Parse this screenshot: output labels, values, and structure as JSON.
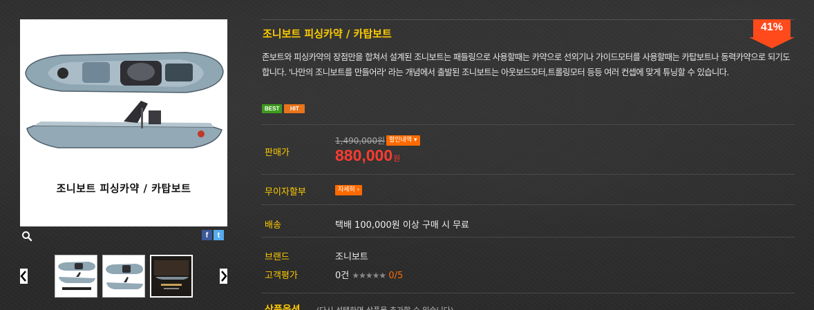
{
  "product": {
    "title": "조니보트 피싱카약 / 카탑보트",
    "image_caption": "조니보트 피싱카약 / 카탑보트",
    "discount": "41%",
    "description": "존보트와 피싱카약의 장점만을 합쳐서 설계된 조니보트는 패들링으로 사용할때는 카약으로 선외기나 가이드모터를 사용할때는 카탑보트나 동력카약으로 되기도 합니다. '나만의 조니보트를 만들어라' 라는 개념에서 출발된 조니보트는 아웃보드모터,트롤링모터 등등 여러 컨셉에 맞게 튜닝할 수 있습니다.",
    "badges": [
      "BEST",
      "HIT"
    ]
  },
  "social": {
    "facebook": "f",
    "twitter": "t"
  },
  "price": {
    "label": "판매가",
    "original": "1,490,000원",
    "discount_button": "할인내역 ▾",
    "sale": "880,000",
    "unit": "원"
  },
  "installment": {
    "label": "무이자할부",
    "button": "자세히 ›"
  },
  "shipping": {
    "label": "배송",
    "value": "택배 100,000원 이상 구매 시 무료"
  },
  "brand": {
    "label": "브랜드",
    "value": "조니보트"
  },
  "review": {
    "label": "고객평가",
    "count": "0건",
    "stars": "★★★★★",
    "score": "0/5"
  },
  "options": {
    "label": "상품옵션",
    "hint": "(다시 선택하면 상품을 추가할 수 있습니다)"
  },
  "thumbnails": [
    {
      "name": "thumb-1",
      "selected": false
    },
    {
      "name": "thumb-2",
      "selected": false
    },
    {
      "name": "thumb-3",
      "selected": true
    }
  ],
  "colors": {
    "accent": "#ffcc00",
    "price": "#ff3b2f",
    "button": "#ff6a00",
    "discount_tag": "#ff4a1c"
  }
}
